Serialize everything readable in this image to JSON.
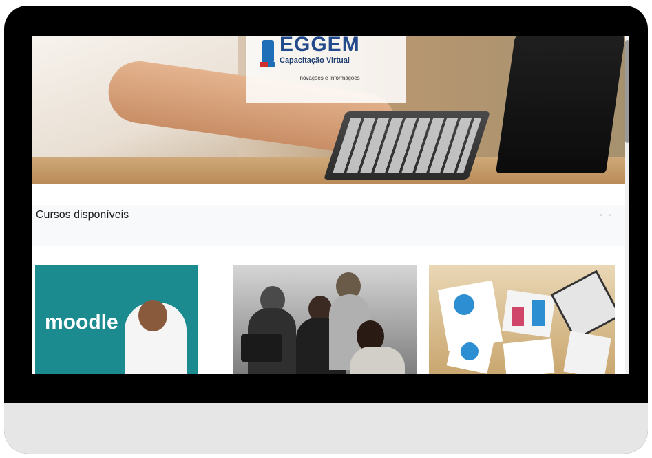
{
  "banner": {
    "logo_title": "EGGEM",
    "logo_subtitle": "Capacitação Virtual",
    "logo_tagline": "Inovações e Informações"
  },
  "section": {
    "title": "Cursos disponíveis",
    "view_toggle": "▫ ▫"
  },
  "courses": [
    {
      "image_text": "moodle",
      "image": "moodle-banner-image"
    },
    {
      "image_text": "",
      "image": "team-meeting-image"
    },
    {
      "image_text": "",
      "image": "desk-charts-image"
    }
  ],
  "colors": {
    "bezel": "#000000",
    "stand": "#e6e6e6",
    "moodle_teal": "#1b8b8f",
    "section_bg": "#f8f9fb"
  }
}
